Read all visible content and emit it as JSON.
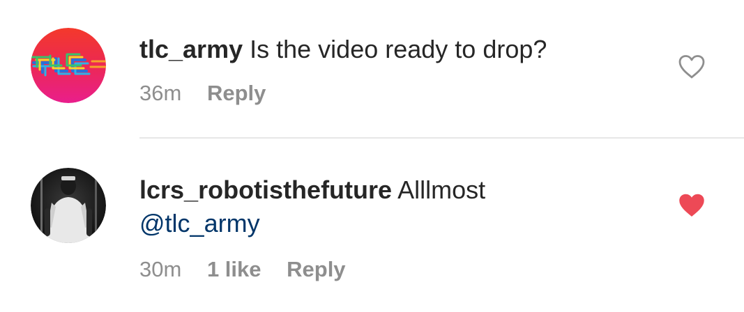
{
  "comments": [
    {
      "username": "tlc_army",
      "text": "Is the video ready to drop?",
      "time": "36m",
      "likes": "",
      "reply_label": "Reply",
      "liked": false,
      "avatar_icon": "tlc-logo-avatar",
      "avatar_text": "TLC"
    },
    {
      "username": "lcrs_robotisthefuture",
      "text": "Alllmost",
      "mention": "@tlc_army",
      "time": "30m",
      "likes": "1 like",
      "reply_label": "Reply",
      "liked": true,
      "avatar_icon": "person-photo-avatar"
    }
  ],
  "colors": {
    "username": "#262626",
    "meta": "#8e8e8e",
    "mention": "#003569",
    "heart_liked": "#ed4956",
    "heart_outline": "#8e8e8e",
    "divider": "#e6e6e6"
  }
}
